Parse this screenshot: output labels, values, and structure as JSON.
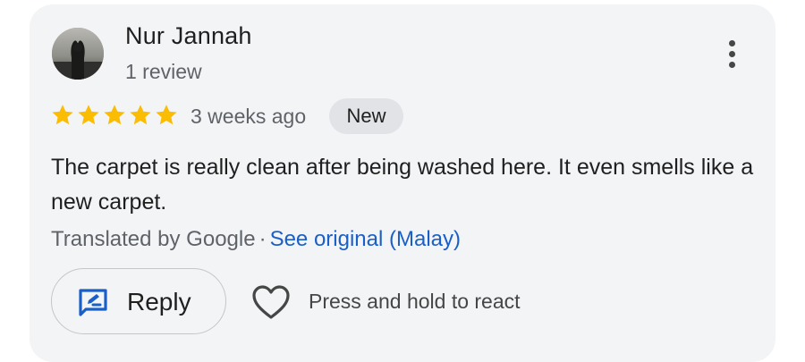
{
  "review": {
    "author": "Nur Jannah",
    "review_count": "1 review",
    "rating": 5,
    "rating_max": 5,
    "time": "3 weeks ago",
    "badge": "New",
    "text": "The carpet is really clean after being washed here. It even smells like a new carpet.",
    "translated_by": "Translated by Google",
    "separator": "·",
    "see_original": "See original (Malay)"
  },
  "actions": {
    "reply_label": "Reply",
    "react_hint": "Press and hold to react"
  },
  "icons": {
    "more": "more-vert-icon",
    "star": "star-icon",
    "reply": "reply-edit-icon",
    "heart": "heart-outline-icon"
  },
  "colors": {
    "card_bg": "#f3f4f6",
    "star": "#fbbc04",
    "link": "#1a5fc7",
    "badge_bg": "#e1e3e6",
    "reply_icon": "#1a5fc7"
  }
}
